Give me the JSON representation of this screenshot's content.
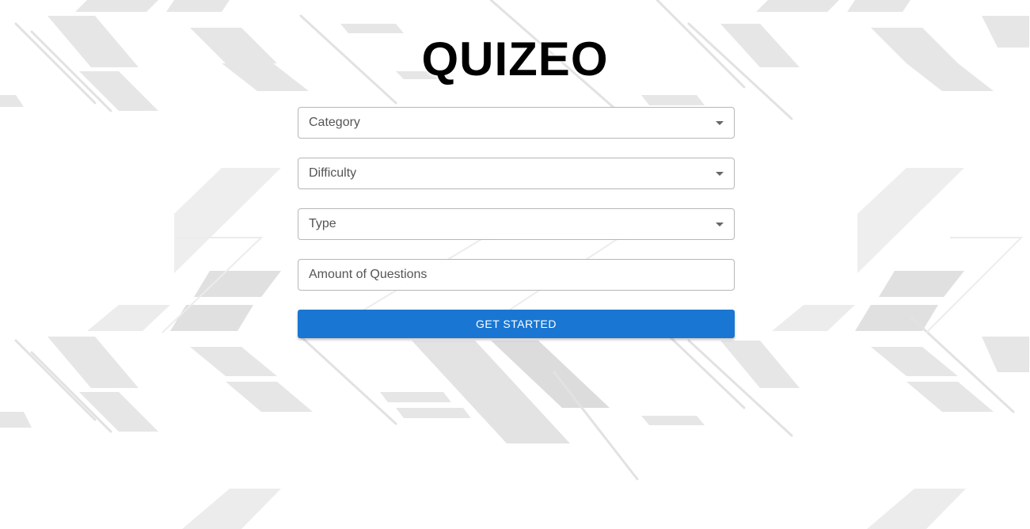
{
  "app": {
    "title": "QUIZEO"
  },
  "form": {
    "category": {
      "label": "Category"
    },
    "difficulty": {
      "label": "Difficulty"
    },
    "type": {
      "label": "Type"
    },
    "amount": {
      "placeholder": "Amount of Questions",
      "value": ""
    },
    "submit_label": "GET STARTED"
  },
  "icons": {
    "select_caret": "caret-down-icon"
  },
  "colors": {
    "primary": "#1976d2",
    "title": "#000000",
    "field_border": "#b7b7b7",
    "background_pattern": "#dcdcdc"
  }
}
